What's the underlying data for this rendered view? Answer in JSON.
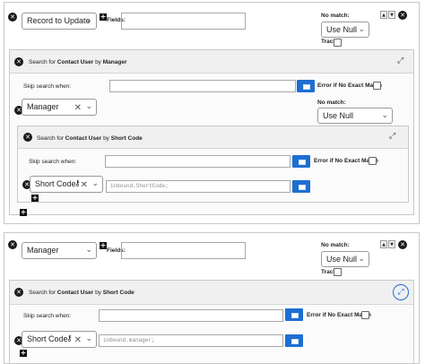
{
  "block1": {
    "record_select": "Record to Update",
    "fields_label": "Fields:",
    "no_match_label": "No match:",
    "no_match_value": "Use Null",
    "track_label": "Track:",
    "search1": {
      "prefix": "Search for ",
      "entity": "Contact User",
      "by": " by ",
      "key": "Manager",
      "skip_label": "Skip search when:",
      "error_label": "Error if No Exact Match",
      "field_select": "Manager",
      "no_match_label": "No match:",
      "no_match_value": "Use Null"
    },
    "search2": {
      "prefix": "Search for ",
      "entity": "Contact User",
      "by": " by ",
      "key": "Short Code",
      "skip_label": "Skip search when:",
      "error_label": "Error if No Exact Match",
      "field_select": "Short Code",
      "expression": "inbound.ShortCode;"
    }
  },
  "block2": {
    "record_select": "Manager",
    "fields_label": "Fields:",
    "no_match_label": "No match:",
    "no_match_value": "Use Null",
    "track_label": "Track:",
    "search1": {
      "prefix": "Search for ",
      "entity": "Contact User",
      "by": " by ",
      "key": "Short Code",
      "skip_label": "Skip search when:",
      "error_label": "Error if No Exact Match",
      "field_select": "Short Code",
      "expression": "inbound.manager;"
    }
  },
  "icons": {
    "remove": "circle-x-icon",
    "add": "plus-square-icon",
    "up": "arrow-up-icon",
    "down": "arrow-down-icon",
    "expand": "expand-icon",
    "key": "key-icon",
    "picker": "calendar-picker-icon"
  },
  "colors": {
    "accent": "#1d6fd1",
    "header_bg": "#f0f0f0",
    "border": "#c8c8c8"
  }
}
